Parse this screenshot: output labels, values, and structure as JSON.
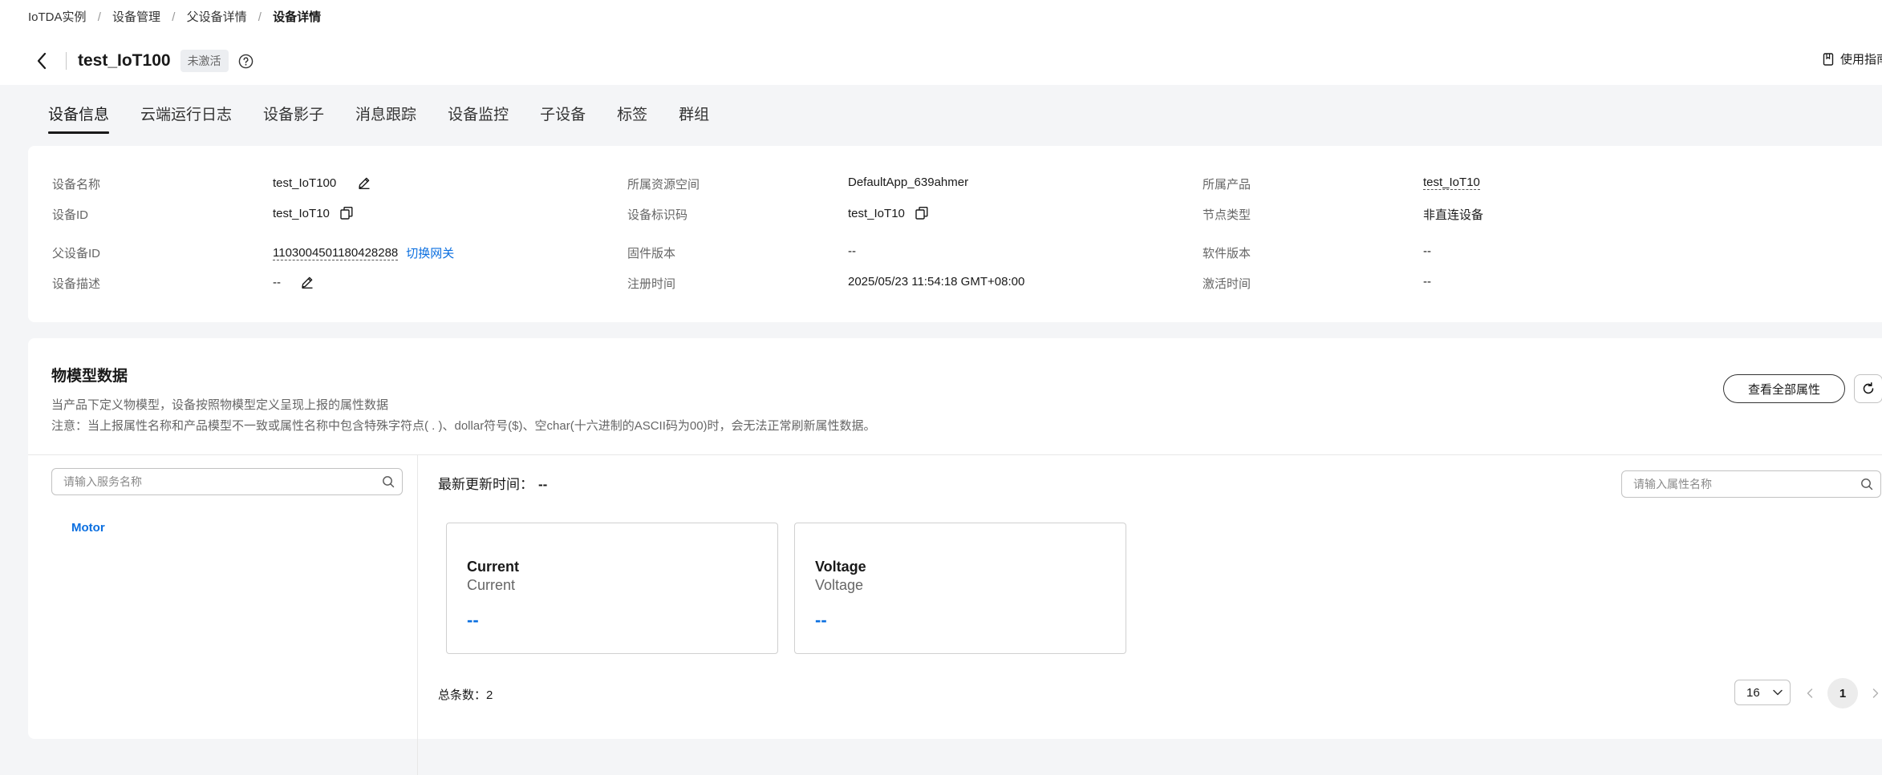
{
  "breadcrumb": {
    "items": [
      "IoTDA实例",
      "设备管理",
      "父设备详情",
      "设备详情"
    ],
    "separator": "/"
  },
  "header": {
    "device_name": "test_IoT100",
    "status": "未激活",
    "guide_label": "使用指南"
  },
  "tabs": [
    "设备信息",
    "云端运行日志",
    "设备影子",
    "消息跟踪",
    "设备监控",
    "子设备",
    "标签",
    "群组"
  ],
  "info": {
    "device_name_label": "设备名称",
    "device_name_value": "test_IoT100",
    "device_id_label": "设备ID",
    "device_id_value": "test_IoT10",
    "parent_id_label": "父设备ID",
    "parent_id_value": "1103004501180428288",
    "switch_gateway": "切换网关",
    "desc_label": "设备描述",
    "desc_value": "--",
    "space_label": "所属资源空间",
    "space_value": "DefaultApp_639ahmer",
    "identifier_label": "设备标识码",
    "identifier_value": "test_IoT10",
    "firmware_label": "固件版本",
    "firmware_value": "--",
    "register_label": "注册时间",
    "register_value": "2025/05/23 11:54:18 GMT+08:00",
    "product_label": "所属产品",
    "product_value": "test_IoT10",
    "node_type_label": "节点类型",
    "node_type_value": "非直连设备",
    "software_label": "软件版本",
    "software_value": "--",
    "activate_label": "激活时间",
    "activate_value": "--"
  },
  "model": {
    "title": "物模型数据",
    "desc": "当产品下定义物模型，设备按照物模型定义呈现上报的属性数据",
    "note": "注意：当上报属性名称和产品模型不一致或属性名称中包含特殊字符点( . )、dollar符号($)、空char(十六进制的ASCII码为00)时，会无法正常刷新属性数据。",
    "view_all": "查看全部属性",
    "service_search_placeholder": "请输入服务名称",
    "services": [
      "Motor"
    ],
    "latest_label": "最新更新时间：",
    "latest_value": "--",
    "prop_search_placeholder": "请输入属性名称",
    "properties": [
      {
        "name": "Current",
        "sub": "Current",
        "value": "--"
      },
      {
        "name": "Voltage",
        "sub": "Voltage",
        "value": "--"
      }
    ],
    "total_label": "总条数：",
    "total_value": "2",
    "page_size": "16",
    "current_page": "1"
  },
  "colors": {
    "link": "#0b6fe0",
    "page_bg": "#f4f5f7"
  }
}
